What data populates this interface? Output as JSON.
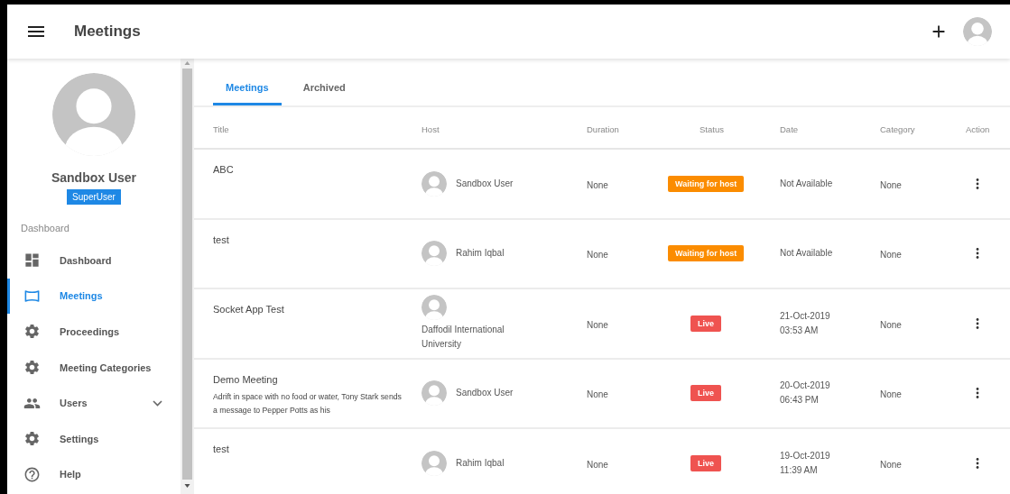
{
  "header": {
    "title": "Meetings"
  },
  "profile": {
    "name": "Sandbox User",
    "role": "SuperUser"
  },
  "sidebar": {
    "section": "Dashboard",
    "items": [
      {
        "label": "Dashboard",
        "kind": "link",
        "selected": false
      },
      {
        "label": "Meetings",
        "kind": "link",
        "selected": true
      },
      {
        "label": "Proceedings",
        "kind": "link",
        "selected": false
      },
      {
        "label": "Meeting Categories",
        "kind": "link",
        "selected": false
      },
      {
        "label": "Users",
        "kind": "group",
        "selected": false,
        "expanded": false
      },
      {
        "label": "Settings",
        "kind": "link",
        "selected": false
      },
      {
        "label": "Help",
        "kind": "link",
        "selected": false
      }
    ]
  },
  "tabs": [
    {
      "label": "Meetings",
      "selected": true
    },
    {
      "label": "Archived",
      "selected": false
    }
  ],
  "table": {
    "columns": [
      "Title",
      "Host",
      "Duration",
      "Status",
      "Date",
      "Category",
      "Action"
    ],
    "rows": [
      {
        "title": "ABC",
        "host": "Sandbox User",
        "duration": "None",
        "status": {
          "label": "Waiting for host",
          "kind": "waiting"
        },
        "date": "Not Available",
        "category": "None"
      },
      {
        "title": "test",
        "host": "Rahim Iqbal",
        "duration": "None",
        "status": {
          "label": "Waiting for host",
          "kind": "waiting"
        },
        "date": "Not Available",
        "category": "None"
      },
      {
        "title": "Socket App Test",
        "host": "Daffodil International University",
        "duration": "None",
        "status": {
          "label": "Live",
          "kind": "live"
        },
        "date": "21-Oct-2019",
        "time": "03:53 AM",
        "category": "None"
      },
      {
        "title": "Demo Meeting",
        "description": "Adrift in space with no food or water, Tony Stark sends a message to Pepper Potts as his",
        "host": "Sandbox User",
        "duration": "None",
        "status": {
          "label": "Live",
          "kind": "live"
        },
        "date": "20-Oct-2019",
        "time": "06:43 PM",
        "category": "None"
      },
      {
        "title": "test",
        "host": "Rahim Iqbal",
        "duration": "None",
        "status": {
          "label": "Live",
          "kind": "live"
        },
        "date": "19-Oct-2019",
        "time": "11:39 AM",
        "category": "None"
      }
    ]
  }
}
